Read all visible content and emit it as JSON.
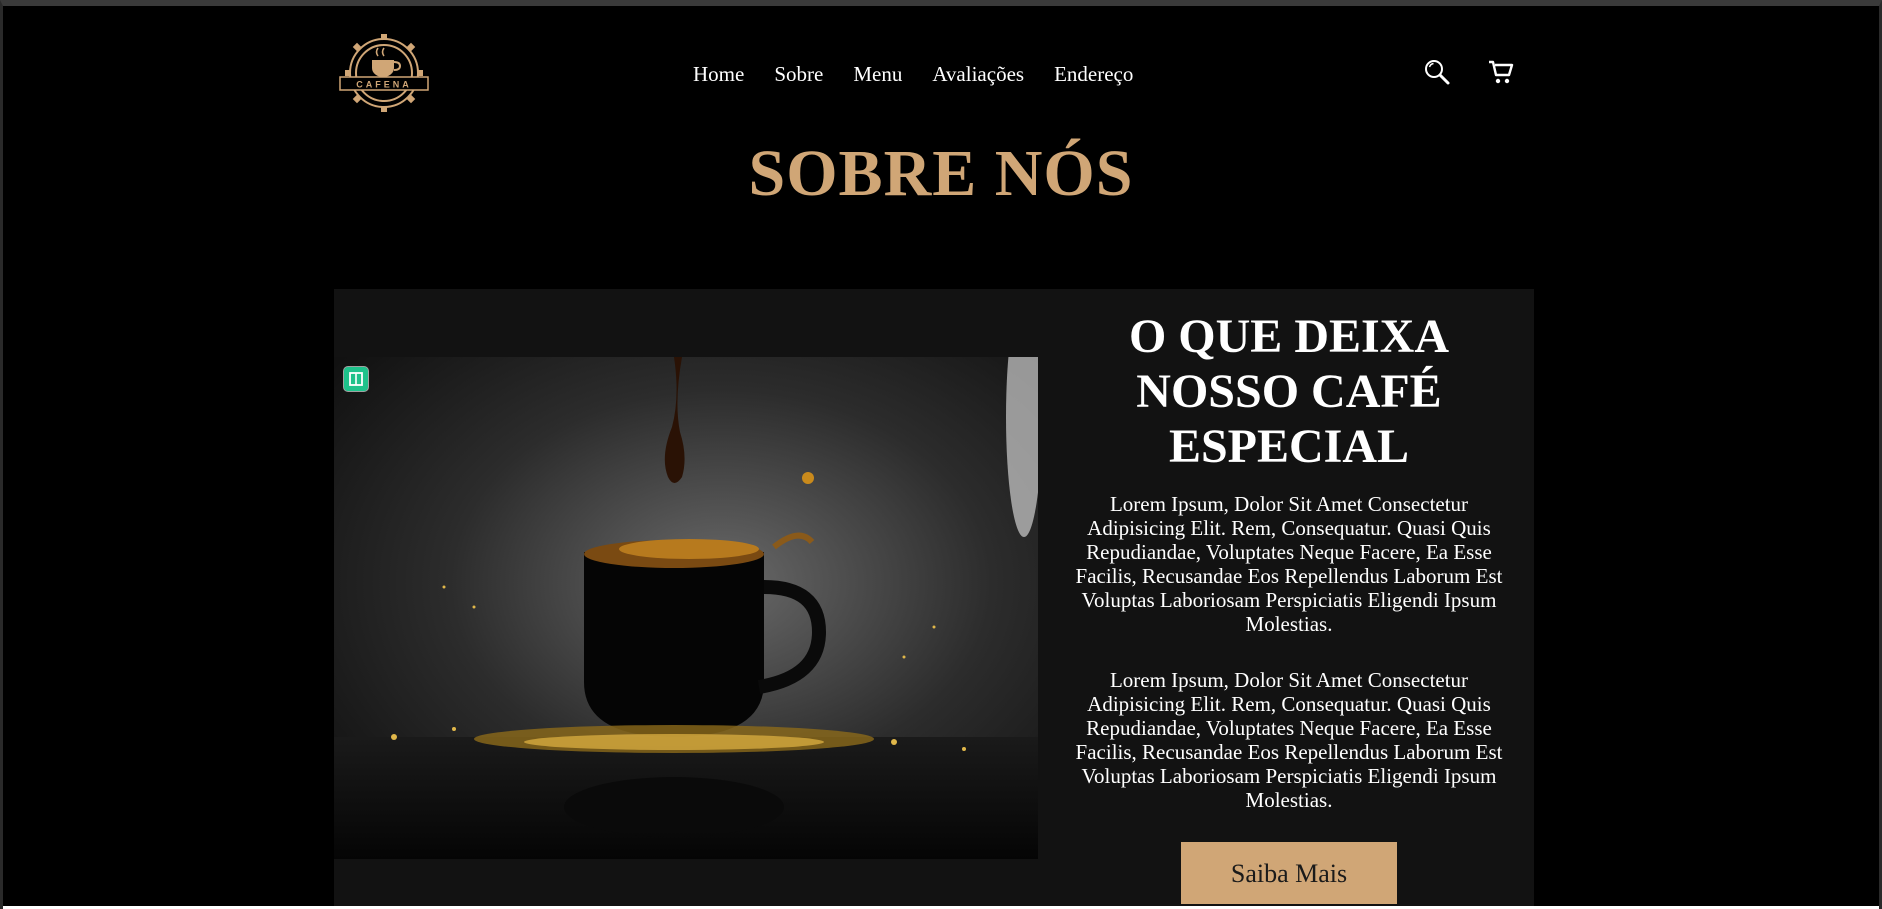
{
  "brand": {
    "logo_text": "CAFENA",
    "accent_color": "#d0a676"
  },
  "nav": {
    "items": [
      "Home",
      "Sobre",
      "Menu",
      "Avaliações",
      "Endereço"
    ]
  },
  "header_icons": [
    "search-icon",
    "cart-icon"
  ],
  "page": {
    "title": "SOBRE NÓS"
  },
  "about": {
    "heading": "O QUE DEIXA NOSSO CAFÉ ESPECIAL",
    "paragraphs": [
      "Lorem Ipsum, Dolor Sit Amet Consectetur Adipisicing Elit. Rem, Consequatur. Quasi Quis Repudiandae, Voluptates Neque Facere, Ea Esse Facilis, Recusandae Eos Repellendus Laborum Est Voluptas Laboriosam Perspiciatis Eligendi Ipsum Molestias.",
      "Lorem Ipsum, Dolor Sit Amet Consectetur Adipisicing Elit. Rem, Consequatur. Quasi Quis Repudiandae, Voluptates Neque Facere, Ea Esse Facilis, Recusandae Eos Repellendus Laborum Est Voluptas Laboriosam Perspiciatis Eligendi Ipsum Molestias."
    ],
    "button_label": "Saiba Mais",
    "image_icon": "coffee-cup-splash-photo"
  }
}
